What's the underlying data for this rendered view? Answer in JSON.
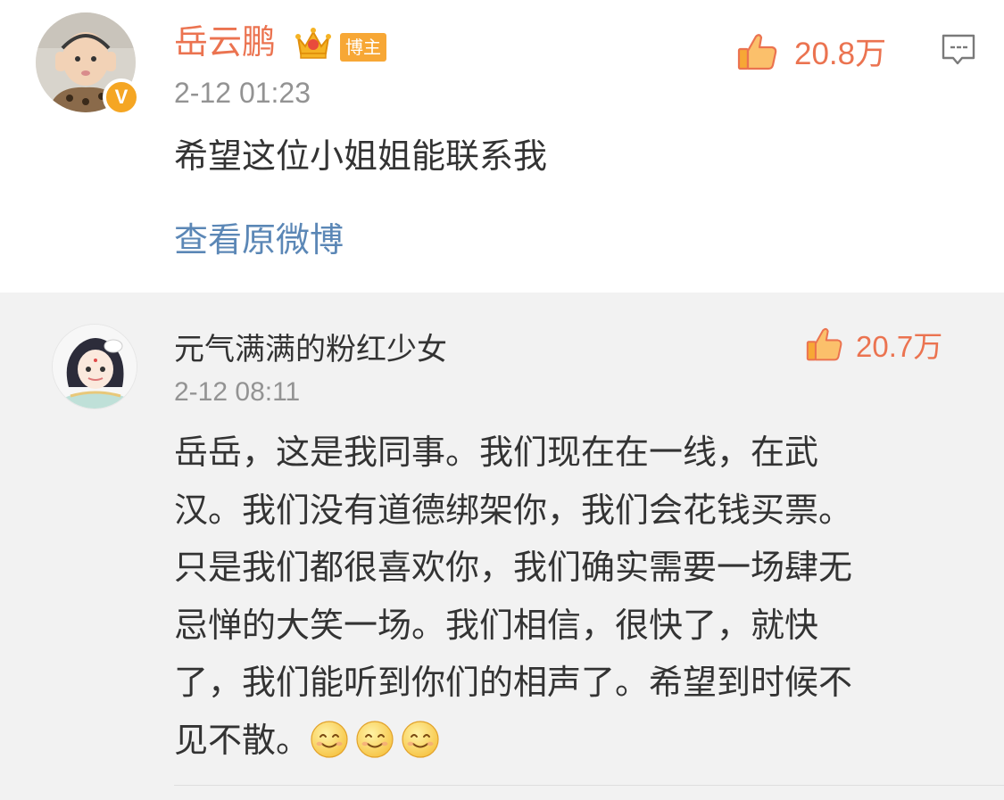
{
  "post": {
    "username": "岳云鹏",
    "badge": "博主",
    "time": "2-12 01:23",
    "text": "希望这位小姐姐能联系我",
    "likes": "20.8万",
    "view_original": "查看原微博",
    "verified_mark": "V",
    "icons": {
      "verified": "verified-v-icon",
      "crown": "crown-icon",
      "like": "thumbs-up-icon",
      "comment": "comment-icon"
    }
  },
  "reply": {
    "username": "元气满满的粉红少女",
    "time": "2-12 08:11",
    "likes": "20.7万",
    "lines": [
      "岳岳，这是我同事。我们现在在一线，在武",
      "汉。我们没有道德绑架你，我们会花钱买票。",
      "只是我们都很喜欢你，我们确实需要一场肆无",
      "忌惮的大笑一场。我们相信，很快了，就快",
      "了，我们能听到你们的相声了。希望到时候不",
      "见不散。"
    ],
    "emoji_count": 3,
    "icons": {
      "emoji": "smile-emoji-icon"
    }
  },
  "colors": {
    "accent": "#eb7350",
    "link": "#5b87b6",
    "meta": "#939393",
    "badge_bg": "#f7a735",
    "reply_bg": "#f2f2f2"
  }
}
